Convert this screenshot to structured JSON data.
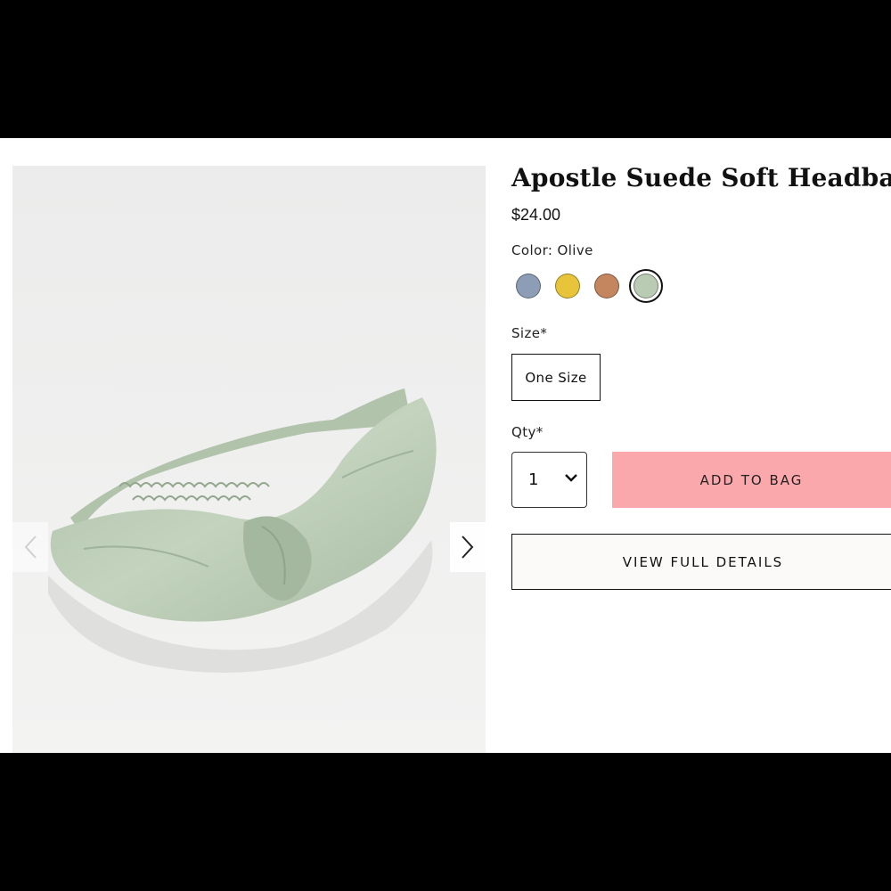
{
  "product": {
    "title": "Apostle Suede Soft Headband",
    "price": "$24.00",
    "image_alt": "Olive suede knotted headband"
  },
  "color": {
    "label": "Color: Olive",
    "swatches": [
      {
        "name": "Blue",
        "hex": "#8c9db5"
      },
      {
        "name": "Yellow",
        "hex": "#e7c43a"
      },
      {
        "name": "Tan",
        "hex": "#c4865f"
      },
      {
        "name": "Olive",
        "hex": "#b9cbb2",
        "selected": true
      }
    ]
  },
  "size": {
    "label": "Size*",
    "option": "One Size"
  },
  "qty": {
    "label": "Qty*",
    "value": "1"
  },
  "buttons": {
    "add_to_bag": "ADD TO BAG",
    "view_full_details": "VIEW FULL DETAILS"
  },
  "colors": {
    "add_to_bag_bg": "#fba8ad",
    "image_bg": "#ececeb"
  },
  "icons": {
    "prev": "chevron-left-icon",
    "next": "chevron-right-icon",
    "qty": "chevron-down-icon"
  }
}
